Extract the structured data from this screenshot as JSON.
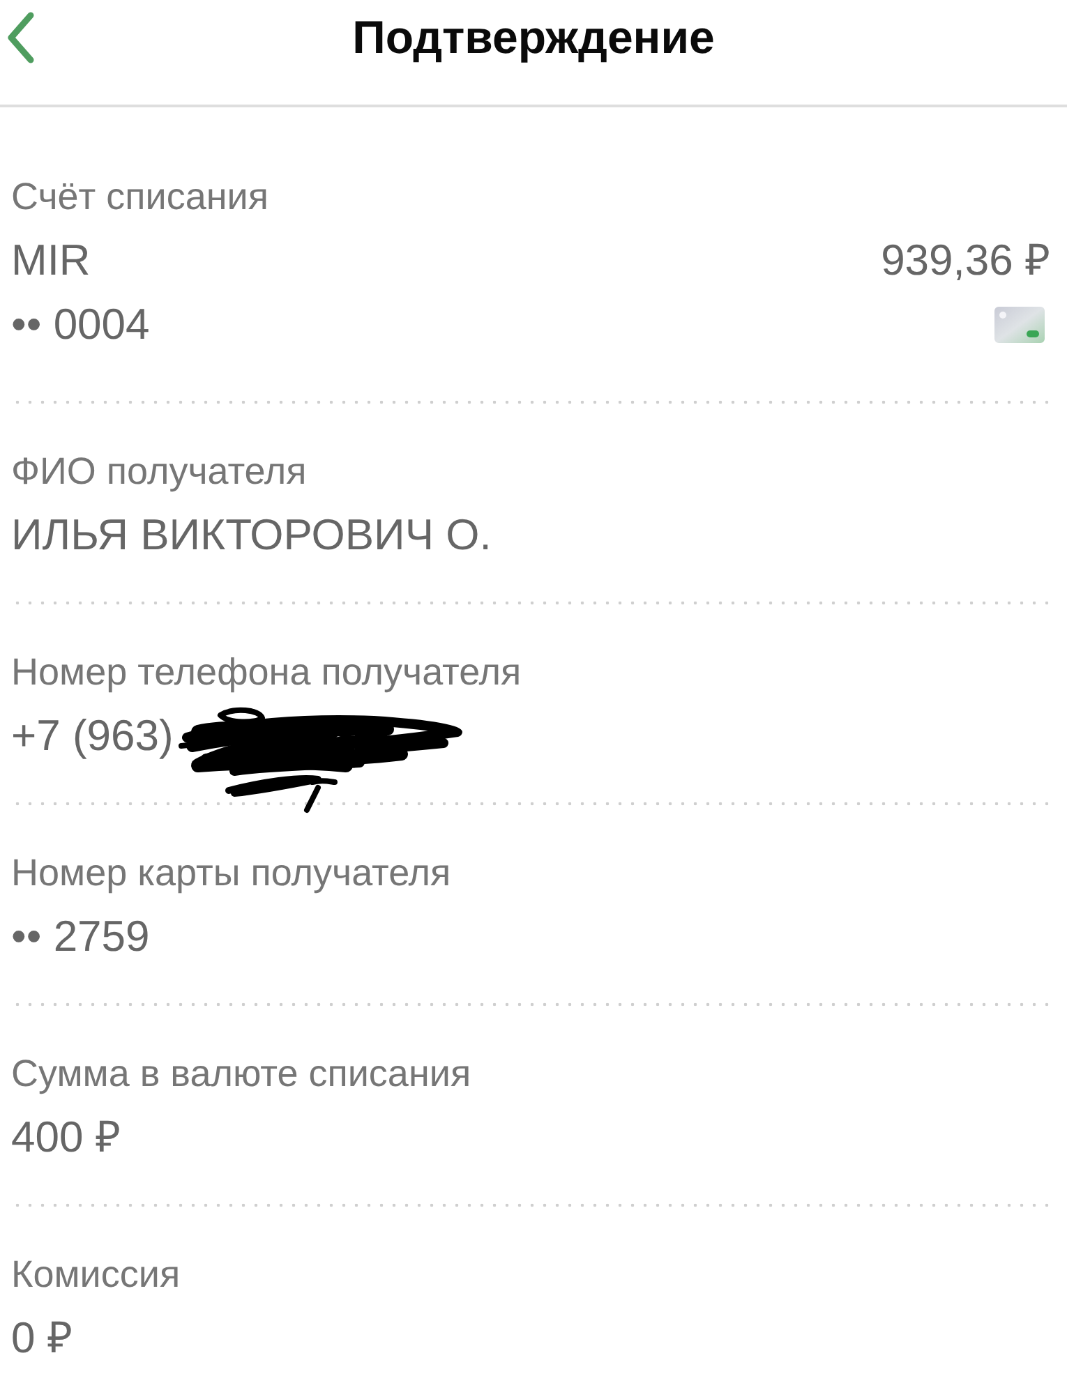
{
  "header": {
    "title": "Подтверждение"
  },
  "account": {
    "label": "Счёт списания",
    "name": "MIR",
    "balance": "939,36 ₽",
    "number": "•• 0004"
  },
  "fields": [
    {
      "label": "ФИО получателя",
      "value": "ИЛЬЯ ВИКТОРОВИЧ О.",
      "redacted": false
    },
    {
      "label": "Номер телефона получателя",
      "value": "+7 (963)",
      "redacted": true
    },
    {
      "label": "Номер карты получателя",
      "value": "•• 2759",
      "redacted": false
    },
    {
      "label": "Сумма в валюте списания",
      "value": "400 ₽",
      "redacted": false
    },
    {
      "label": "Комиссия",
      "value": "0 ₽",
      "redacted": false
    }
  ]
}
